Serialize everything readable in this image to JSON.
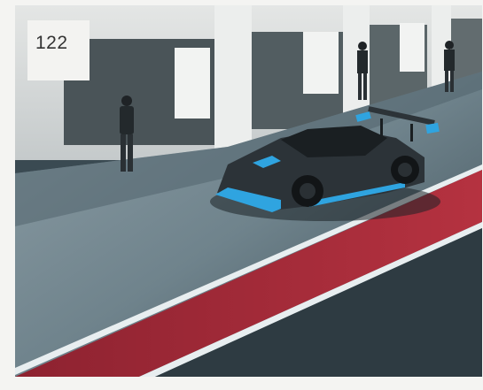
{
  "page": {
    "number": "122"
  },
  "photo": {
    "subject": "race-car-in-pit-lane",
    "colors": {
      "track": "#7b8c94",
      "pit_lane_red": "#a32a36",
      "car_body": "#2c3338",
      "car_accent": "#2fa4e0",
      "building": "#d9dcdb"
    }
  }
}
